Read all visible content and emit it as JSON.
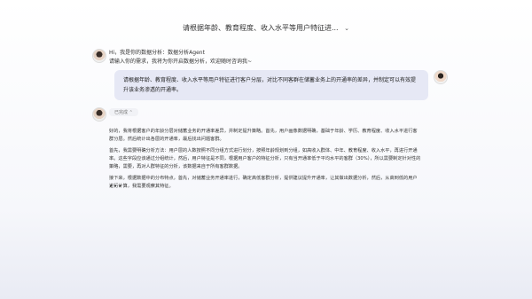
{
  "header": {
    "title": "请根据年龄、教育程度、收入水平等用户特征进...",
    "dropdown_icon": "chevron-down-icon"
  },
  "bot": {
    "intro_line1": "Hi，我是你的数据分析：数据分析Agent",
    "intro_line2": "请输入你的需求，我将为你开启数据分析，欢迎随时咨询我~"
  },
  "user": {
    "message": "请根据年龄、教育程度、收入水平等用户特征进行客户分层，对比不同客群在储蓄业务上的开通率的差异，并制定可以有效提升该业务渗透的开通率。"
  },
  "tool_call": {
    "label": "已完成",
    "icon": "chevron-up-icon"
  },
  "answer": {
    "p1": "好的，我将根据客户的年龄分层对储蓄业务的开通率差异，并制定提升策略。首先，用户画像数据明确，基础于年龄、学历、教育程度、收入水平进行客群分层。然后统计出各层的开通率，最后找出问题客群。",
    "p2": "首先，我需要明确分析方法：用户层的人数按照不同分组方式进行划分，按照年龄规划到分组，如高收入群体、中年、教育程度、收入水平，再进行开通率。这些字段应该通过分组统计，然后，用户特征是不同，根据用户客户的特征分析，只有当开通率低于平均水平的客群（30%），所以需要制定针对性的策略，需要，再对人群特征的分析，该数据来自于所有客群数据。",
    "p3": "接下来，根据数据中的分布特点，首先，对储蓄业务开通率进行，确定高低客群分析，提供建议提升开通率，让其做出数据分析，然后，从高到低的用户进行计算，我需要观察其特征。"
  },
  "typing_indicator": "•••"
}
